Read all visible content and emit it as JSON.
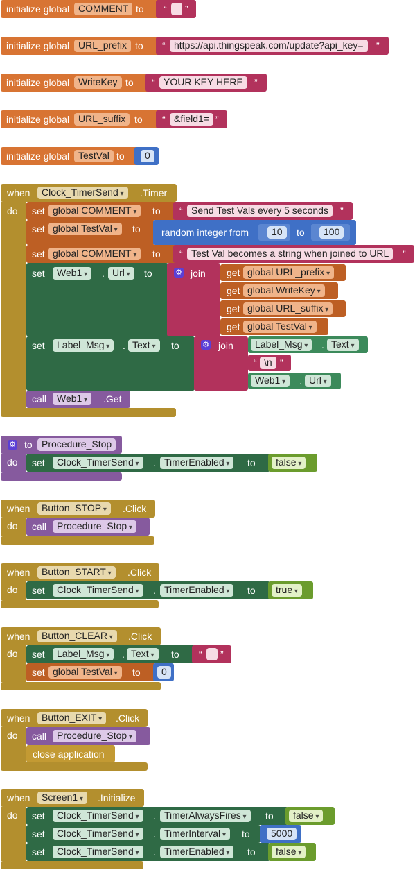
{
  "globals": [
    {
      "init": "initialize global",
      "name": "COMMENT",
      "to": "to",
      "value": "",
      "type": "text"
    },
    {
      "init": "initialize global",
      "name": "URL_prefix",
      "to": "to",
      "value": "https://api.thingspeak.com/update?api_key=",
      "type": "text"
    },
    {
      "init": "initialize global",
      "name": "WriteKey",
      "to": "to",
      "value": "YOUR KEY HERE",
      "type": "text"
    },
    {
      "init": "initialize global",
      "name": "URL_suffix",
      "to": "to",
      "value": "&field1=",
      "type": "text"
    },
    {
      "init": "initialize global",
      "name": "TestVal",
      "to": "to",
      "value": "0",
      "type": "number"
    }
  ],
  "kw": {
    "when": "when",
    "do": "do",
    "set": "set",
    "get": "get",
    "call": "call",
    "to": "to",
    "join": "join",
    "dot": ".",
    "random": "random integer from",
    "quote": "“",
    "quote_end": "”",
    "close": "close application",
    "to_proc": "to"
  },
  "timer_event": {
    "component": "Clock_TimerSend",
    "event": ".Timer",
    "set1_var": "global COMMENT",
    "set1_val": "Send Test Vals every 5 seconds",
    "set2_var": "global TestVal",
    "rand_from": "10",
    "rand_to": "100",
    "set3_var": "global COMMENT",
    "set3_val": "Test Val becomes a string when joined to URL",
    "web_comp": "Web1",
    "web_prop": "Url",
    "join_items": [
      "global URL_prefix",
      "global WriteKey",
      "global URL_suffix",
      "global TestVal"
    ],
    "label_comp": "Label_Msg",
    "label_prop": "Text",
    "newline": "\\n",
    "call_comp": "Web1",
    "call_method": ".Get"
  },
  "proc_stop": {
    "name": "Procedure_Stop",
    "comp": "Clock_TimerSend",
    "prop": "TimerEnabled",
    "value": "false"
  },
  "btn_stop": {
    "component": "Button_STOP",
    "event": ".Click",
    "proc": "Procedure_Stop"
  },
  "btn_start": {
    "component": "Button_START",
    "event": ".Click",
    "comp": "Clock_TimerSend",
    "prop": "TimerEnabled",
    "value": "true"
  },
  "btn_clear": {
    "component": "Button_CLEAR",
    "event": ".Click",
    "comp": "Label_Msg",
    "prop": "Text",
    "text": "",
    "var": "global TestVal",
    "num": "0"
  },
  "btn_exit": {
    "component": "Button_EXIT",
    "event": ".Click",
    "proc": "Procedure_Stop"
  },
  "screen_init": {
    "component": "Screen1",
    "event": ".Initialize",
    "rows": [
      {
        "comp": "Clock_TimerSend",
        "prop": "TimerAlwaysFires",
        "value": "false"
      },
      {
        "comp": "Clock_TimerSend",
        "prop": "TimerInterval",
        "value": "5000"
      },
      {
        "comp": "Clock_TimerSend",
        "prop": "TimerEnabled",
        "value": "false"
      }
    ]
  },
  "colors": {
    "variables": "#d87433",
    "text": "#b2325c",
    "math": "#3f70c6",
    "control": "#b38f2e",
    "component": "#2f6a45",
    "logic": "#6b9c2d",
    "procedure": "#865a9e"
  }
}
